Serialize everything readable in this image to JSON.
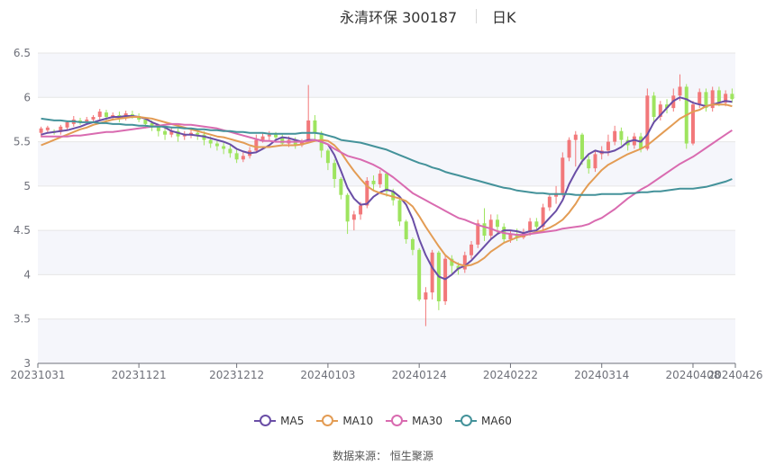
{
  "header": {
    "stock": "永清环保 300187",
    "period": "日K"
  },
  "source": "数据来源：  恒生聚源",
  "colors": {
    "up": "#f2787a",
    "down": "#9ee45f",
    "grid": "#e6e6e6",
    "axis": "#6e7079",
    "band": "#f5f6fb"
  },
  "chart_data": {
    "type": "candlestick",
    "ylim": [
      3,
      6.5
    ],
    "yticks": [
      "3",
      "3.5",
      "4",
      "4.5",
      "5",
      "5.5",
      "6",
      "6.5"
    ],
    "grid": true,
    "legend_position": "bottom",
    "x_tick_labels": [
      "20231031",
      "20231121",
      "20231212",
      "20240103",
      "20240124",
      "20240222",
      "20240314",
      "20240408",
      "20240426"
    ],
    "candles": [
      [
        5.6,
        5.65,
        5.55,
        5.67
      ],
      [
        5.63,
        5.66,
        5.6,
        5.68
      ],
      [
        5.62,
        5.6,
        5.58,
        5.64
      ],
      [
        5.61,
        5.67,
        5.58,
        5.69
      ],
      [
        5.66,
        5.72,
        5.63,
        5.74
      ],
      [
        5.7,
        5.75,
        5.67,
        5.79
      ],
      [
        5.74,
        5.72,
        5.69,
        5.77
      ],
      [
        5.73,
        5.75,
        5.7,
        5.78
      ],
      [
        5.75,
        5.78,
        5.73,
        5.8
      ],
      [
        5.78,
        5.84,
        5.75,
        5.87
      ],
      [
        5.83,
        5.78,
        5.74,
        5.86
      ],
      [
        5.78,
        5.8,
        5.74,
        5.83
      ],
      [
        5.8,
        5.77,
        5.72,
        5.84
      ],
      [
        5.77,
        5.82,
        5.74,
        5.85
      ],
      [
        5.81,
        5.79,
        5.76,
        5.85
      ],
      [
        5.79,
        5.75,
        5.72,
        5.82
      ],
      [
        5.75,
        5.7,
        5.65,
        5.78
      ],
      [
        5.71,
        5.67,
        5.62,
        5.74
      ],
      [
        5.67,
        5.62,
        5.56,
        5.7
      ],
      [
        5.62,
        5.58,
        5.52,
        5.66
      ],
      [
        5.58,
        5.62,
        5.55,
        5.67
      ],
      [
        5.62,
        5.56,
        5.5,
        5.65
      ],
      [
        5.56,
        5.58,
        5.52,
        5.62
      ],
      [
        5.58,
        5.6,
        5.54,
        5.64
      ],
      [
        5.6,
        5.58,
        5.52,
        5.63
      ],
      [
        5.58,
        5.52,
        5.46,
        5.62
      ],
      [
        5.52,
        5.48,
        5.43,
        5.56
      ],
      [
        5.48,
        5.45,
        5.4,
        5.52
      ],
      [
        5.45,
        5.42,
        5.36,
        5.49
      ],
      [
        5.42,
        5.37,
        5.32,
        5.46
      ],
      [
        5.37,
        5.3,
        5.26,
        5.42
      ],
      [
        5.3,
        5.34,
        5.27,
        5.38
      ],
      [
        5.34,
        5.4,
        5.31,
        5.44
      ],
      [
        5.4,
        5.52,
        5.38,
        5.58
      ],
      [
        5.52,
        5.56,
        5.49,
        5.6
      ],
      [
        5.56,
        5.58,
        5.52,
        5.62
      ],
      [
        5.58,
        5.55,
        5.5,
        5.61
      ],
      [
        5.55,
        5.48,
        5.45,
        5.58
      ],
      [
        5.48,
        5.52,
        5.44,
        5.56
      ],
      [
        5.52,
        5.46,
        5.42,
        5.55
      ],
      [
        5.46,
        5.5,
        5.44,
        5.53
      ],
      [
        5.5,
        5.74,
        5.48,
        6.14
      ],
      [
        5.74,
        5.6,
        5.5,
        5.8
      ],
      [
        5.6,
        5.4,
        5.32,
        5.62
      ],
      [
        5.4,
        5.26,
        5.18,
        5.42
      ],
      [
        5.26,
        5.08,
        4.98,
        5.3
      ],
      [
        5.08,
        4.9,
        4.85,
        5.1
      ],
      [
        4.9,
        4.6,
        4.46,
        4.92
      ],
      [
        4.62,
        4.68,
        4.5,
        4.72
      ],
      [
        4.68,
        4.78,
        4.62,
        4.82
      ],
      [
        4.78,
        5.06,
        4.75,
        5.1
      ],
      [
        5.06,
        5.02,
        4.96,
        5.12
      ],
      [
        5.02,
        5.14,
        4.98,
        5.18
      ],
      [
        5.14,
        4.94,
        4.88,
        5.16
      ],
      [
        4.94,
        4.84,
        4.78,
        4.97
      ],
      [
        4.84,
        4.6,
        4.55,
        4.86
      ],
      [
        4.6,
        4.4,
        4.35,
        4.62
      ],
      [
        4.4,
        4.28,
        4.22,
        4.42
      ],
      [
        4.28,
        3.72,
        3.7,
        4.3
      ],
      [
        3.72,
        3.8,
        3.42,
        3.86
      ],
      [
        3.8,
        4.25,
        3.72,
        4.28
      ],
      [
        4.25,
        3.7,
        3.6,
        4.27
      ],
      [
        3.7,
        4.18,
        3.66,
        4.22
      ],
      [
        4.18,
        4.1,
        4.0,
        4.22
      ],
      [
        4.1,
        4.06,
        4.0,
        4.14
      ],
      [
        4.06,
        4.22,
        4.02,
        4.26
      ],
      [
        4.22,
        4.34,
        4.18,
        4.38
      ],
      [
        4.34,
        4.58,
        4.3,
        4.62
      ],
      [
        4.58,
        4.44,
        4.38,
        4.75
      ],
      [
        4.44,
        4.62,
        4.4,
        4.68
      ],
      [
        4.62,
        4.54,
        4.46,
        4.68
      ],
      [
        4.54,
        4.4,
        4.36,
        4.58
      ],
      [
        4.4,
        4.46,
        4.36,
        4.5
      ],
      [
        4.46,
        4.42,
        4.38,
        4.52
      ],
      [
        4.42,
        4.48,
        4.4,
        4.52
      ],
      [
        4.48,
        4.6,
        4.44,
        4.64
      ],
      [
        4.6,
        4.54,
        4.5,
        4.64
      ],
      [
        4.54,
        4.76,
        4.5,
        4.8
      ],
      [
        4.76,
        4.88,
        4.72,
        4.9
      ],
      [
        4.88,
        4.92,
        4.8,
        5.0
      ],
      [
        4.92,
        5.32,
        4.88,
        5.38
      ],
      [
        5.32,
        5.52,
        5.28,
        5.55
      ],
      [
        5.52,
        5.58,
        5.22,
        5.62
      ],
      [
        5.58,
        5.3,
        5.24,
        5.6
      ],
      [
        5.3,
        5.2,
        5.14,
        5.34
      ],
      [
        5.2,
        5.36,
        5.16,
        5.4
      ],
      [
        5.36,
        5.4,
        5.3,
        5.45
      ],
      [
        5.4,
        5.5,
        5.34,
        5.58
      ],
      [
        5.5,
        5.62,
        5.46,
        5.68
      ],
      [
        5.62,
        5.52,
        5.46,
        5.66
      ],
      [
        5.52,
        5.46,
        5.4,
        5.56
      ],
      [
        5.46,
        5.56,
        5.42,
        5.6
      ],
      [
        5.56,
        5.42,
        5.38,
        5.6
      ],
      [
        5.42,
        6.02,
        5.4,
        6.1
      ],
      [
        6.02,
        5.78,
        5.7,
        6.06
      ],
      [
        5.78,
        5.92,
        5.74,
        5.96
      ],
      [
        5.92,
        5.88,
        5.82,
        5.98
      ],
      [
        5.88,
        6.02,
        5.84,
        6.1
      ],
      [
        6.02,
        6.12,
        5.96,
        6.26
      ],
      [
        6.12,
        5.48,
        5.42,
        6.15
      ],
      [
        5.48,
        5.92,
        5.46,
        5.96
      ],
      [
        5.92,
        6.06,
        5.88,
        6.1
      ],
      [
        6.06,
        5.88,
        5.84,
        6.1
      ],
      [
        5.88,
        6.08,
        5.84,
        6.12
      ],
      [
        6.08,
        5.94,
        5.9,
        6.12
      ],
      [
        5.94,
        6.04,
        5.9,
        6.08
      ],
      [
        6.04,
        5.98,
        5.94,
        6.1
      ]
    ],
    "series": [
      {
        "name": "MA5",
        "color": "#6a4ea6",
        "values": [
          5.58,
          5.6,
          5.61,
          5.62,
          5.63,
          5.65,
          5.67,
          5.7,
          5.72,
          5.74,
          5.76,
          5.78,
          5.78,
          5.79,
          5.79,
          5.78,
          5.76,
          5.72,
          5.69,
          5.66,
          5.62,
          5.6,
          5.58,
          5.58,
          5.57,
          5.56,
          5.54,
          5.52,
          5.5,
          5.47,
          5.42,
          5.39,
          5.37,
          5.38,
          5.42,
          5.46,
          5.52,
          5.55,
          5.54,
          5.52,
          5.5,
          5.52,
          5.52,
          5.5,
          5.47,
          5.35,
          5.17,
          4.98,
          4.86,
          4.79,
          4.8,
          4.88,
          4.93,
          4.96,
          4.94,
          4.88,
          4.79,
          4.63,
          4.4,
          4.22,
          4.08,
          3.98,
          3.95,
          4.0,
          4.07,
          4.1,
          4.16,
          4.24,
          4.32,
          4.4,
          4.46,
          4.5,
          4.5,
          4.49,
          4.47,
          4.49,
          4.5,
          4.56,
          4.64,
          4.72,
          4.84,
          5.02,
          5.16,
          5.28,
          5.36,
          5.4,
          5.38,
          5.38,
          5.4,
          5.44,
          5.5,
          5.52,
          5.5,
          5.58,
          5.72,
          5.8,
          5.88,
          5.96,
          6.0,
          5.98,
          5.94,
          5.92,
          5.9,
          5.92,
          5.94,
          5.96,
          5.95
        ]
      },
      {
        "name": "MA10",
        "color": "#e39c54",
        "values": [
          5.46,
          5.49,
          5.52,
          5.55,
          5.58,
          5.61,
          5.64,
          5.66,
          5.69,
          5.71,
          5.73,
          5.75,
          5.76,
          5.77,
          5.78,
          5.78,
          5.77,
          5.76,
          5.74,
          5.72,
          5.7,
          5.68,
          5.66,
          5.64,
          5.62,
          5.6,
          5.58,
          5.56,
          5.55,
          5.53,
          5.51,
          5.49,
          5.46,
          5.44,
          5.44,
          5.44,
          5.45,
          5.46,
          5.46,
          5.46,
          5.47,
          5.49,
          5.51,
          5.52,
          5.51,
          5.46,
          5.38,
          5.27,
          5.17,
          5.08,
          5.0,
          4.95,
          4.92,
          4.9,
          4.88,
          4.86,
          4.83,
          4.77,
          4.66,
          4.54,
          4.43,
          4.32,
          4.22,
          4.16,
          4.12,
          4.1,
          4.11,
          4.14,
          4.19,
          4.26,
          4.31,
          4.36,
          4.39,
          4.42,
          4.44,
          4.46,
          4.48,
          4.5,
          4.53,
          4.57,
          4.62,
          4.7,
          4.8,
          4.92,
          5.02,
          5.1,
          5.18,
          5.24,
          5.28,
          5.32,
          5.36,
          5.39,
          5.42,
          5.46,
          5.52,
          5.58,
          5.64,
          5.7,
          5.76,
          5.8,
          5.84,
          5.86,
          5.9,
          5.92,
          5.92,
          5.92,
          5.9
        ]
      },
      {
        "name": "MA30",
        "color": "#d96bb0",
        "values": [
          5.56,
          5.56,
          5.56,
          5.56,
          5.56,
          5.57,
          5.57,
          5.58,
          5.59,
          5.6,
          5.61,
          5.61,
          5.62,
          5.63,
          5.64,
          5.65,
          5.66,
          5.67,
          5.68,
          5.69,
          5.7,
          5.7,
          5.69,
          5.69,
          5.68,
          5.67,
          5.66,
          5.65,
          5.63,
          5.61,
          5.59,
          5.57,
          5.55,
          5.53,
          5.51,
          5.51,
          5.5,
          5.5,
          5.5,
          5.5,
          5.5,
          5.51,
          5.52,
          5.5,
          5.47,
          5.42,
          5.38,
          5.34,
          5.32,
          5.3,
          5.27,
          5.24,
          5.2,
          5.15,
          5.1,
          5.04,
          4.98,
          4.92,
          4.88,
          4.84,
          4.8,
          4.76,
          4.72,
          4.68,
          4.64,
          4.62,
          4.59,
          4.56,
          4.54,
          4.52,
          4.49,
          4.47,
          4.46,
          4.45,
          4.45,
          4.46,
          4.47,
          4.48,
          4.49,
          4.5,
          4.52,
          4.53,
          4.54,
          4.55,
          4.57,
          4.61,
          4.64,
          4.69,
          4.74,
          4.8,
          4.86,
          4.91,
          4.96,
          5.0,
          5.05,
          5.1,
          5.15,
          5.2,
          5.25,
          5.29,
          5.33,
          5.38,
          5.43,
          5.48,
          5.53,
          5.58,
          5.63
        ]
      },
      {
        "name": "MA60",
        "color": "#44929a",
        "values": [
          5.76,
          5.75,
          5.74,
          5.74,
          5.73,
          5.73,
          5.72,
          5.72,
          5.72,
          5.71,
          5.71,
          5.7,
          5.7,
          5.69,
          5.69,
          5.68,
          5.68,
          5.67,
          5.67,
          5.67,
          5.66,
          5.66,
          5.65,
          5.65,
          5.64,
          5.64,
          5.63,
          5.63,
          5.62,
          5.62,
          5.61,
          5.61,
          5.6,
          5.6,
          5.6,
          5.59,
          5.59,
          5.59,
          5.59,
          5.59,
          5.6,
          5.6,
          5.6,
          5.59,
          5.57,
          5.55,
          5.52,
          5.51,
          5.5,
          5.49,
          5.47,
          5.45,
          5.43,
          5.41,
          5.38,
          5.35,
          5.32,
          5.29,
          5.26,
          5.24,
          5.21,
          5.19,
          5.16,
          5.14,
          5.12,
          5.1,
          5.08,
          5.06,
          5.04,
          5.02,
          5.0,
          4.98,
          4.97,
          4.95,
          4.94,
          4.93,
          4.92,
          4.92,
          4.91,
          4.91,
          4.91,
          4.91,
          4.9,
          4.9,
          4.9,
          4.9,
          4.91,
          4.91,
          4.91,
          4.91,
          4.92,
          4.92,
          4.93,
          4.93,
          4.94,
          4.94,
          4.95,
          4.96,
          4.97,
          4.97,
          4.97,
          4.98,
          4.99,
          5.01,
          5.03,
          5.05,
          5.08
        ]
      }
    ]
  }
}
